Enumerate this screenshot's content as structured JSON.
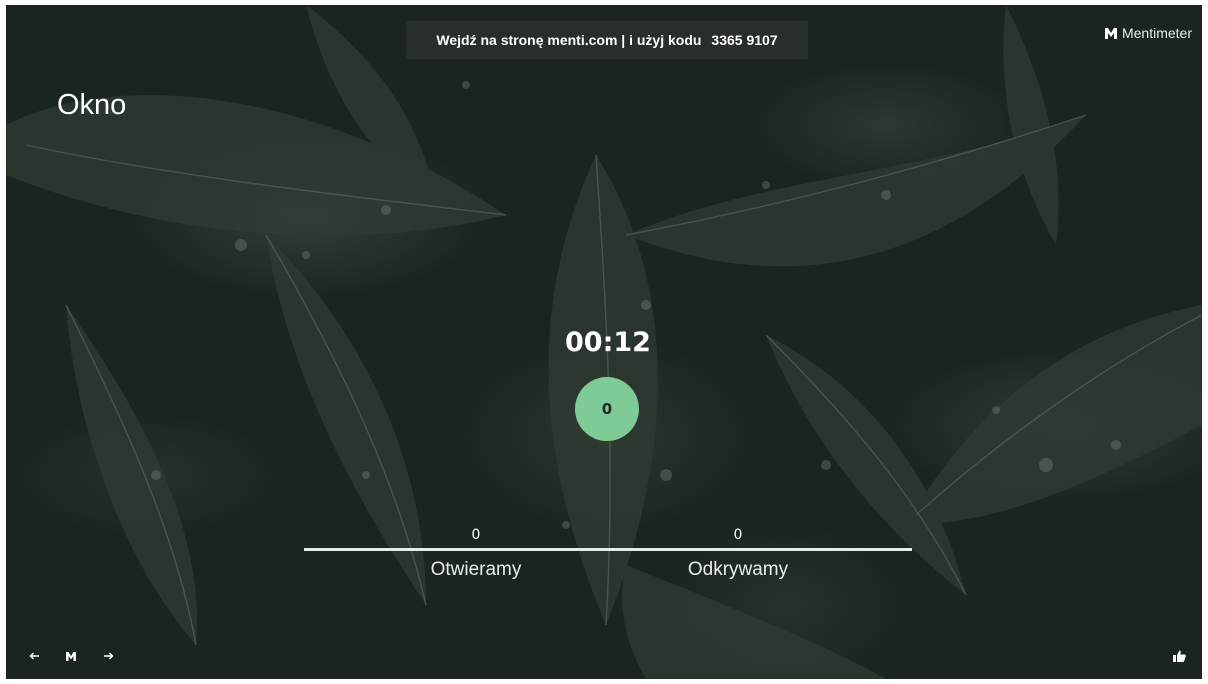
{
  "header": {
    "join_text": "Wejdź na stronę menti.com | i użyj kodu",
    "code": "3365 9107",
    "brand_name": "Mentimeter"
  },
  "slide": {
    "title": "Okno",
    "timer": "00:12",
    "total_votes": "0",
    "options": [
      {
        "label": "Otwieramy",
        "count": "0"
      },
      {
        "label": "Odkrywamy",
        "count": "0"
      }
    ]
  },
  "controls": {
    "prev_icon": "arrow-left-icon",
    "menu_icon": "mentimeter-logo-icon",
    "next_icon": "arrow-right-icon",
    "reaction_icon": "thumbs-up-icon"
  },
  "colors": {
    "accent": "#7fcb98",
    "background": "#1c2420"
  }
}
